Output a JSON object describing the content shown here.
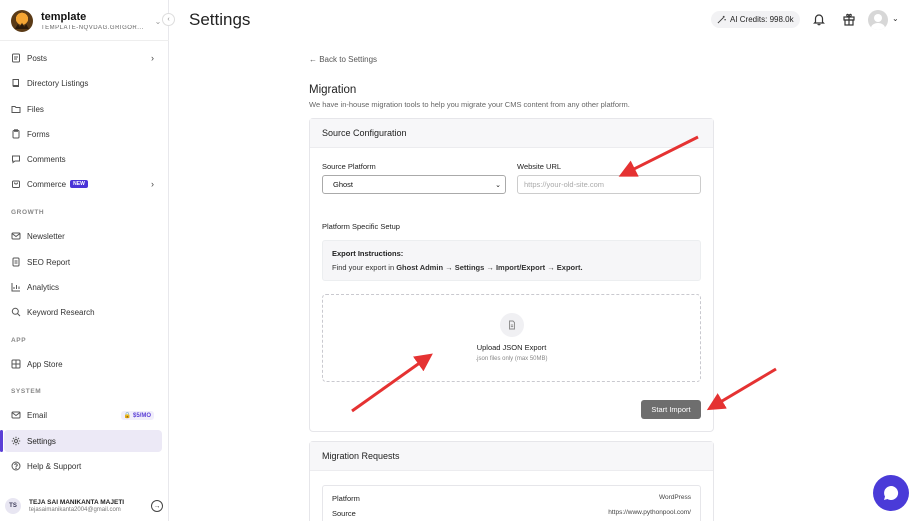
{
  "workspace": {
    "name": "template",
    "subtitle": "TEMPLATE-NQVDAG.GRIGOR..."
  },
  "sidebar": {
    "items": [
      {
        "label": "Posts",
        "icon": "document-icon"
      },
      {
        "label": "Directory Listings",
        "icon": "book-icon"
      },
      {
        "label": "Files",
        "icon": "folder-icon"
      },
      {
        "label": "Forms",
        "icon": "clipboard-icon"
      },
      {
        "label": "Comments",
        "icon": "comment-icon"
      },
      {
        "label": "Commerce",
        "icon": "cart-icon",
        "badge": "NEW"
      }
    ],
    "growth_label": "GROWTH",
    "growth_items": [
      {
        "label": "Newsletter",
        "icon": "mail-icon"
      },
      {
        "label": "SEO Report",
        "icon": "report-icon"
      },
      {
        "label": "Analytics",
        "icon": "chart-icon"
      },
      {
        "label": "Keyword Research",
        "icon": "search-icon"
      }
    ],
    "app_label": "APP",
    "app_items": [
      {
        "label": "App Store",
        "icon": "grid-icon"
      }
    ],
    "system_label": "SYSTEM",
    "system_items": [
      {
        "label": "Email",
        "icon": "mail-icon",
        "badge": "$5/MO"
      },
      {
        "label": "Settings",
        "icon": "gear-icon",
        "active": true
      },
      {
        "label": "Help & Support",
        "icon": "help-icon"
      }
    ]
  },
  "user": {
    "initials": "TS",
    "name": "TEJA SAI MANIKANTA MAJETI",
    "email": "tejasaimanikanta2004@gmail.com"
  },
  "header": {
    "title": "Settings",
    "ai_credits": "AI Credits: 998.0k"
  },
  "main": {
    "back_link": "← Back to Settings",
    "heading": "Migration",
    "description": "We have in-house migration tools to help you migrate your CMS content from any other platform.",
    "source_config": {
      "title": "Source Configuration",
      "platform_label": "Source Platform",
      "platform_value": "Ghost",
      "url_label": "Website URL",
      "url_placeholder": "https://your-old-site.com",
      "setup_label": "Platform Specific Setup",
      "instructions_title": "Export Instructions:",
      "instructions_prefix": "Find your export in",
      "instructions_path": "Ghost Admin → Settings → Import/Export → Export.",
      "upload_title": "Upload JSON Export",
      "upload_hint": ".json files only (max 50MB)",
      "start_button": "Start Import"
    },
    "requests": {
      "title": "Migration Requests",
      "platform_label": "Platform",
      "platform_value": "WordPress",
      "source_label": "Source",
      "source_value": "https://www.pythonpool.com/"
    }
  },
  "colors": {
    "accent": "#4b34d8",
    "arrow": "#e53232",
    "button": "#6e6e6e"
  }
}
